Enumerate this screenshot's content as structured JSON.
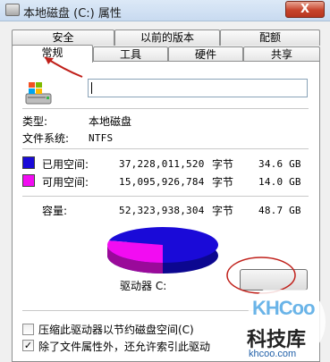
{
  "window": {
    "title": "本地磁盘 (C:) 属性",
    "close_label": "X"
  },
  "tabs_row1": [
    {
      "label": "安全"
    },
    {
      "label": "以前的版本"
    },
    {
      "label": "配额"
    }
  ],
  "tabs_row2": [
    {
      "label": "常规",
      "active": true
    },
    {
      "label": "工具"
    },
    {
      "label": "硬件"
    },
    {
      "label": "共享"
    }
  ],
  "general": {
    "name_value": "",
    "type_label": "类型:",
    "type_value": "本地磁盘",
    "fs_label": "文件系统:",
    "fs_value": "NTFS",
    "used_label": "已用空间:",
    "used_bytes": "37,228,011,520",
    "used_unit": "字节",
    "used_size": "34.6 GB",
    "free_label": "可用空间:",
    "free_bytes": "15,095,926,784",
    "free_unit": "字节",
    "free_size": "14.0 GB",
    "capacity_label": "容量:",
    "capacity_bytes": "52,323,938,304",
    "capacity_unit": "字节",
    "capacity_size": "48.7 GB",
    "drive_label": "驱动器 C:",
    "used_fraction": 0.7115,
    "colors": {
      "used": "#1a0ad8",
      "free": "#f20cf2"
    }
  },
  "options": {
    "compress_label": "压缩此驱动器以节约磁盘空间(C)",
    "compress_checked": false,
    "index_label": "除了文件属性外，还允许索引此驱动",
    "index_checked": true
  },
  "watermark": {
    "brand": "KHCoo",
    "name_cn": "科技库",
    "url": "khcoo.com"
  }
}
